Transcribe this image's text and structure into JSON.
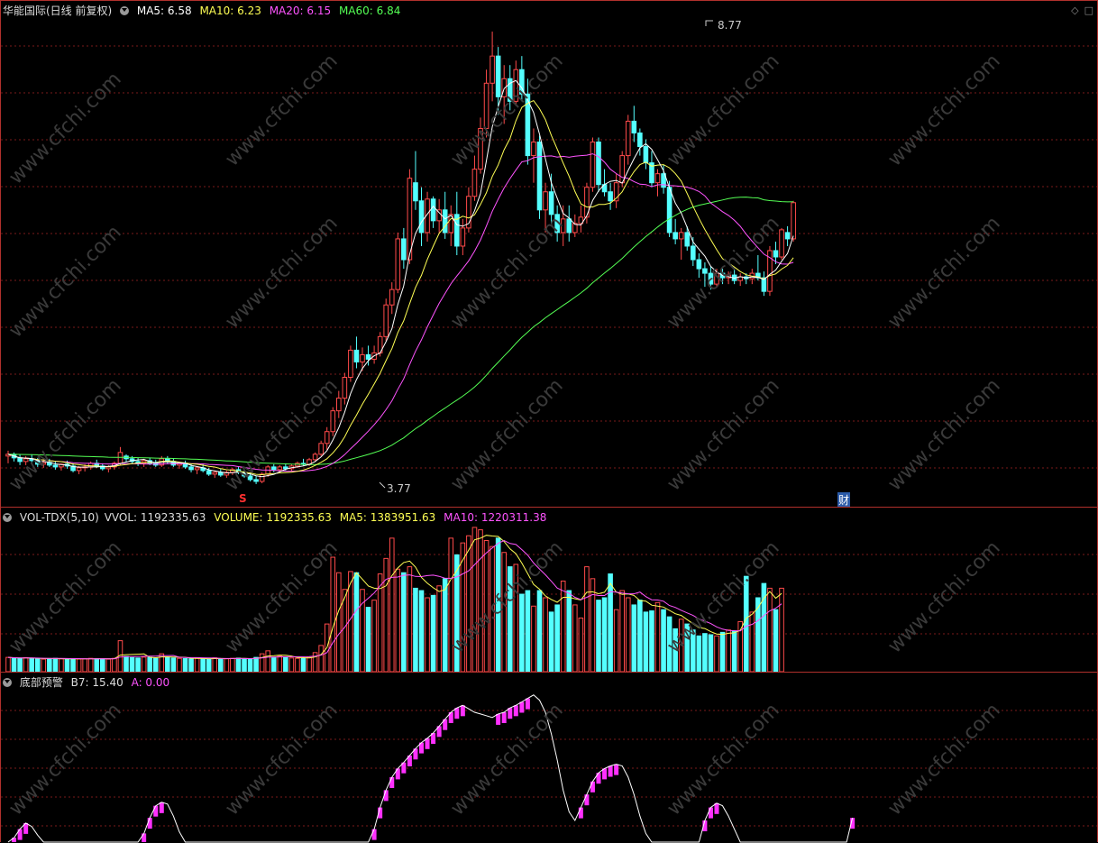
{
  "main_panel": {
    "title": "华能国际(日线 前复权)",
    "ma5": "MA5: 6.58",
    "ma10": "MA10: 6.23",
    "ma20": "MA20: 6.15",
    "ma60": "MA60: 6.84",
    "high_label": "8.77",
    "low_label": "3.77",
    "marker_s": "S",
    "marker_cai": "财",
    "icons": [
      "diamond-icon",
      "square-icon"
    ]
  },
  "volume_panel": {
    "name": "VOL-TDX(5,10)",
    "vvol": "VVOL: 1192335.63",
    "volume": "VOLUME: 1192335.63",
    "ma5": "MA5: 1383951.63",
    "ma10": "MA10: 1220311.38"
  },
  "indicator_panel": {
    "name": "底部预警",
    "b7": "B7: 15.40",
    "a": "A: 0.00"
  },
  "watermark": "www.cfchi.com",
  "colors": {
    "up": "#ff4a4a",
    "down": "#54ffff",
    "ma5": "#ffffff",
    "ma10": "#ffff54",
    "ma20": "#ff54ff",
    "ma60": "#54ff54",
    "border": "#b0302c",
    "grid": "#7a1a1a"
  },
  "chart_data": {
    "type": "candlestick",
    "high": 8.77,
    "low": 3.77,
    "candles": [
      [
        4.08,
        4.14,
        4.0,
        4.1
      ],
      [
        4.1,
        4.12,
        4.02,
        4.06
      ],
      [
        4.06,
        4.1,
        3.98,
        4.02
      ],
      [
        4.02,
        4.08,
        3.98,
        4.05
      ],
      [
        4.05,
        4.1,
        4.0,
        4.03
      ],
      [
        4.03,
        4.06,
        3.96,
        3.99
      ],
      [
        3.99,
        4.04,
        3.95,
        4.01
      ],
      [
        4.01,
        4.05,
        3.96,
        3.98
      ],
      [
        3.98,
        4.02,
        3.93,
        3.96
      ],
      [
        3.96,
        4.0,
        3.92,
        3.99
      ],
      [
        3.99,
        4.03,
        3.94,
        3.97
      ],
      [
        3.97,
        4.0,
        3.9,
        3.92
      ],
      [
        3.92,
        3.97,
        3.88,
        3.95
      ],
      [
        3.95,
        3.99,
        3.91,
        3.96
      ],
      [
        3.96,
        4.02,
        3.93,
        4.0
      ],
      [
        4.0,
        4.04,
        3.95,
        3.97
      ],
      [
        3.97,
        4.0,
        3.92,
        3.94
      ],
      [
        3.94,
        3.98,
        3.9,
        3.96
      ],
      [
        3.96,
        4.02,
        3.93,
        4.0
      ],
      [
        4.0,
        4.18,
        3.98,
        4.12
      ],
      [
        4.08,
        4.1,
        4.02,
        4.05
      ],
      [
        4.05,
        4.08,
        3.99,
        4.02
      ],
      [
        4.02,
        4.06,
        3.97,
        4.0
      ],
      [
        4.0,
        4.05,
        3.96,
        4.03
      ],
      [
        4.03,
        4.06,
        3.98,
        4.0
      ],
      [
        4.0,
        4.04,
        3.96,
        3.98
      ],
      [
        3.98,
        4.08,
        3.96,
        4.05
      ],
      [
        4.05,
        4.08,
        3.99,
        4.02
      ],
      [
        4.02,
        4.05,
        3.96,
        3.98
      ],
      [
        3.98,
        4.02,
        3.94,
        4.0
      ],
      [
        4.0,
        4.03,
        3.94,
        3.96
      ],
      [
        3.96,
        3.99,
        3.9,
        3.93
      ],
      [
        3.93,
        3.97,
        3.88,
        3.95
      ],
      [
        3.95,
        3.99,
        3.9,
        3.92
      ],
      [
        3.92,
        3.95,
        3.86,
        3.88
      ],
      [
        3.88,
        3.92,
        3.84,
        3.9
      ],
      [
        3.9,
        3.94,
        3.85,
        3.87
      ],
      [
        3.87,
        3.92,
        3.84,
        3.9
      ],
      [
        3.9,
        3.95,
        3.87,
        3.93
      ],
      [
        3.93,
        3.96,
        3.88,
        3.9
      ],
      [
        3.9,
        3.93,
        3.84,
        3.86
      ],
      [
        3.86,
        3.9,
        3.8,
        3.82
      ],
      [
        3.82,
        3.86,
        3.77,
        3.8
      ],
      [
        3.8,
        3.9,
        3.78,
        3.88
      ],
      [
        3.88,
        3.98,
        3.85,
        3.96
      ],
      [
        3.96,
        3.99,
        3.9,
        3.93
      ],
      [
        3.93,
        3.98,
        3.9,
        3.96
      ],
      [
        3.96,
        4.0,
        3.92,
        3.94
      ],
      [
        3.94,
        3.99,
        3.91,
        3.97
      ],
      [
        3.97,
        4.02,
        3.95,
        4.0
      ],
      [
        4.0,
        4.05,
        3.97,
        3.99
      ],
      [
        3.99,
        4.06,
        3.97,
        4.04
      ],
      [
        4.04,
        4.12,
        4.02,
        4.1
      ],
      [
        4.1,
        4.25,
        4.08,
        4.22
      ],
      [
        4.22,
        4.4,
        4.15,
        4.35
      ],
      [
        4.35,
        4.62,
        4.3,
        4.58
      ],
      [
        4.58,
        4.8,
        4.5,
        4.72
      ],
      [
        4.72,
        5.0,
        4.65,
        4.95
      ],
      [
        4.95,
        5.3,
        4.9,
        5.25
      ],
      [
        5.25,
        5.4,
        5.05,
        5.12
      ],
      [
        5.12,
        5.28,
        5.02,
        5.2
      ],
      [
        5.2,
        5.3,
        5.08,
        5.15
      ],
      [
        5.15,
        5.3,
        5.1,
        5.22
      ],
      [
        5.22,
        5.45,
        5.18,
        5.4
      ],
      [
        5.4,
        5.82,
        5.35,
        5.75
      ],
      [
        5.75,
        6.0,
        5.65,
        5.92
      ],
      [
        5.92,
        6.55,
        5.88,
        6.48
      ],
      [
        6.48,
        6.6,
        6.15,
        6.25
      ],
      [
        6.25,
        7.25,
        6.2,
        7.15
      ],
      [
        7.1,
        7.45,
        6.8,
        6.9
      ],
      [
        6.9,
        7.05,
        6.4,
        6.55
      ],
      [
        6.55,
        7.0,
        6.45,
        6.92
      ],
      [
        6.92,
        6.95,
        6.6,
        6.68
      ],
      [
        6.68,
        6.92,
        6.55,
        6.8
      ],
      [
        6.8,
        7.0,
        6.48,
        6.55
      ],
      [
        6.55,
        6.85,
        6.4,
        6.75
      ],
      [
        6.75,
        7.0,
        6.3,
        6.4
      ],
      [
        6.4,
        6.7,
        6.3,
        6.6
      ],
      [
        6.6,
        7.05,
        6.55,
        6.95
      ],
      [
        6.95,
        7.4,
        6.9,
        7.25
      ],
      [
        7.25,
        7.82,
        7.2,
        7.7
      ],
      [
        7.7,
        8.35,
        7.6,
        8.2
      ],
      [
        8.2,
        8.77,
        8.0,
        8.5
      ],
      [
        8.5,
        8.6,
        7.85,
        8.05
      ],
      [
        8.05,
        8.4,
        7.75,
        8.25
      ],
      [
        8.25,
        8.4,
        7.9,
        8.0
      ],
      [
        8.0,
        8.45,
        7.95,
        8.35
      ],
      [
        8.35,
        8.5,
        8.0,
        8.08
      ],
      [
        8.08,
        8.25,
        7.3,
        7.4
      ],
      [
        7.4,
        7.7,
        7.1,
        7.55
      ],
      [
        7.55,
        7.62,
        6.7,
        6.8
      ],
      [
        6.8,
        7.1,
        6.55,
        7.0
      ],
      [
        7.0,
        7.2,
        6.65,
        6.75
      ],
      [
        6.75,
        6.85,
        6.45,
        6.55
      ],
      [
        6.55,
        6.85,
        6.4,
        6.7
      ],
      [
        6.7,
        6.85,
        6.45,
        6.55
      ],
      [
        6.55,
        6.75,
        6.5,
        6.65
      ],
      [
        6.65,
        6.85,
        6.55,
        6.72
      ],
      [
        6.72,
        7.1,
        6.65,
        7.05
      ],
      [
        7.05,
        7.6,
        7.0,
        7.55
      ],
      [
        7.55,
        7.6,
        7.0,
        7.08
      ],
      [
        7.08,
        7.25,
        6.95,
        7.0
      ],
      [
        7.0,
        7.1,
        6.8,
        6.9
      ],
      [
        6.9,
        7.2,
        6.82,
        7.1
      ],
      [
        7.1,
        7.45,
        7.05,
        7.4
      ],
      [
        7.4,
        7.85,
        7.3,
        7.78
      ],
      [
        7.78,
        7.95,
        7.55,
        7.65
      ],
      [
        7.65,
        7.7,
        7.4,
        7.5
      ],
      [
        7.5,
        7.58,
        7.25,
        7.32
      ],
      [
        7.32,
        7.45,
        7.05,
        7.1
      ],
      [
        7.1,
        7.25,
        6.95,
        7.2
      ],
      [
        7.2,
        7.3,
        6.98,
        7.05
      ],
      [
        7.05,
        7.12,
        6.5,
        6.55
      ],
      [
        6.55,
        6.7,
        6.42,
        6.48
      ],
      [
        6.48,
        6.6,
        6.25,
        6.55
      ],
      [
        6.55,
        6.62,
        6.35,
        6.4
      ],
      [
        6.4,
        6.5,
        6.18,
        6.25
      ],
      [
        6.25,
        6.32,
        6.05,
        6.15
      ],
      [
        6.15,
        6.22,
        5.95,
        6.1
      ],
      [
        6.1,
        6.18,
        5.92,
        5.98
      ],
      [
        5.98,
        6.15,
        5.95,
        6.1
      ],
      [
        6.1,
        6.15,
        5.98,
        6.05
      ],
      [
        6.05,
        6.12,
        5.98,
        6.08
      ],
      [
        6.08,
        6.15,
        5.98,
        6.02
      ],
      [
        6.02,
        6.1,
        5.96,
        6.06
      ],
      [
        6.06,
        6.1,
        5.98,
        6.04
      ],
      [
        6.04,
        6.15,
        5.98,
        6.1
      ],
      [
        6.1,
        6.3,
        6.02,
        6.05
      ],
      [
        6.05,
        6.12,
        5.85,
        5.9
      ],
      [
        5.9,
        6.4,
        5.85,
        6.35
      ],
      [
        6.35,
        6.45,
        6.2,
        6.28
      ],
      [
        6.28,
        6.6,
        6.25,
        6.58
      ],
      [
        6.55,
        6.62,
        6.4,
        6.48
      ],
      [
        6.48,
        6.9,
        6.45,
        6.88
      ]
    ],
    "volume": [
      120,
      115,
      110,
      118,
      112,
      108,
      105,
      110,
      112,
      108,
      104,
      110,
      106,
      108,
      112,
      110,
      108,
      105,
      112,
      260,
      128,
      118,
      115,
      122,
      120,
      112,
      150,
      118,
      115,
      112,
      110,
      108,
      112,
      110,
      104,
      116,
      110,
      108,
      112,
      114,
      110,
      104,
      120,
      150,
      175,
      120,
      130,
      118,
      115,
      112,
      110,
      120,
      160,
      220,
      400,
      960,
      830,
      690,
      840,
      830,
      690,
      540,
      600,
      820,
      950,
      1120,
      860,
      830,
      880,
      700,
      680,
      620,
      640,
      720,
      780,
      1120,
      980,
      1080,
      1140,
      1210,
      1190,
      1100,
      1050,
      1120,
      1000,
      880,
      900,
      650,
      680,
      550,
      680,
      620,
      500,
      560,
      760,
      680,
      560,
      450,
      880,
      780,
      600,
      620,
      820,
      520,
      680,
      620,
      560,
      600,
      500,
      510,
      580,
      520,
      460,
      360,
      440,
      400,
      350,
      300,
      320,
      310,
      300,
      330,
      350,
      340,
      420,
      800,
      500,
      620,
      740,
      700,
      520,
      700
    ],
    "indicator": [
      0,
      5,
      15,
      22,
      18,
      8,
      0,
      0,
      0,
      0,
      0,
      0,
      0,
      0,
      0,
      0,
      0,
      0,
      0,
      0,
      0,
      0,
      0,
      10,
      28,
      42,
      46,
      44,
      30,
      12,
      0,
      0,
      0,
      0,
      0,
      0,
      0,
      0,
      0,
      0,
      0,
      0,
      0,
      0,
      0,
      0,
      0,
      0,
      0,
      0,
      0,
      0,
      0,
      0,
      0,
      0,
      0,
      0,
      0,
      0,
      0,
      0,
      15,
      40,
      60,
      75,
      85,
      92,
      100,
      108,
      115,
      120,
      126,
      134,
      142,
      150,
      155,
      158,
      154,
      150,
      148,
      146,
      144,
      148,
      150,
      155,
      158,
      162,
      166,
      170,
      164,
      150,
      125,
      95,
      60,
      35,
      25,
      40,
      55,
      70,
      80,
      85,
      88,
      90,
      88,
      75,
      55,
      30,
      10,
      0,
      0,
      0,
      0,
      0,
      0,
      0,
      0,
      0,
      25,
      40,
      45,
      42,
      30,
      15,
      0,
      0,
      0,
      0,
      0,
      0,
      0,
      0,
      0,
      0,
      0,
      0,
      0,
      0,
      0,
      0,
      0,
      0,
      0,
      28
    ]
  }
}
